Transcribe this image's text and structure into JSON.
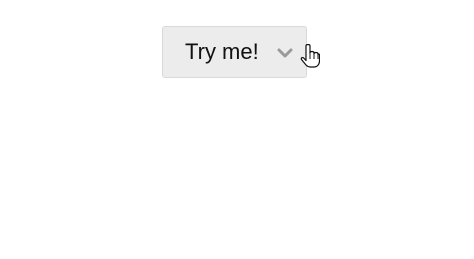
{
  "dropdown": {
    "label": "Try me!",
    "chevron_icon": "chevron-down-icon"
  },
  "pointer": {
    "icon": "hand-pointer-cursor-icon"
  },
  "colors": {
    "page_background": "#ffffff",
    "button_background": "#ececec",
    "button_border": "#d9d9d9",
    "label_text": "#111111",
    "chevron": "#9a9a9a"
  }
}
